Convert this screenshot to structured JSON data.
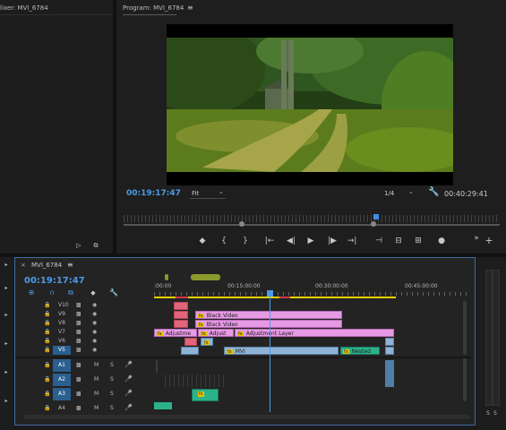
{
  "mixer_panel": {
    "title": "lixer: MVI_6784",
    "timecode": "",
    "bottom_icons": [
      "▸◂",
      "⧉"
    ]
  },
  "program_panel": {
    "title": "Program: MVI_6784",
    "menu_icon": "hamburger-icon",
    "timecode": "00:19:17:47",
    "fit_label": "Fit",
    "quality_label": "1/4",
    "duration": "00:40:29:41"
  },
  "transport": {
    "buttons": [
      "◆",
      "{",
      "}",
      "|←",
      "◀|",
      "▶",
      "|▶",
      "→|",
      "⊣",
      "⊟",
      "⊞",
      "●",
      "»",
      "+"
    ]
  },
  "timeline": {
    "tab_title": "MVI_6784",
    "timecode": "00:19:17:47",
    "ruler": [
      ":00:00",
      "00:15:00:00",
      "00:30:00:00",
      "00:45:00:00"
    ],
    "video_tracks": [
      "V10",
      "V9",
      "V8",
      "V7",
      "V6",
      "V5"
    ],
    "audio_tracks": [
      "A1",
      "A2",
      "A3",
      "A4"
    ],
    "audio_m": "M",
    "audio_s": "S",
    "clips": {
      "black_video_1": "Black Video",
      "black_video_2": "Black Video",
      "adjustme": "Adjustme",
      "adjust": "Adjust",
      "adjustment_layer": "Adjustment Layer",
      "mvi": "MVI",
      "nested": "Nested",
      "fx": "fx"
    }
  },
  "meter": {
    "labels": [
      "S",
      "S"
    ]
  },
  "colors": {
    "accent": "#4a9be8",
    "clip_pink": "#e79ae4",
    "clip_red": "#e2667b",
    "clip_cyan": "#8fb3d6",
    "clip_green": "#2bb28b",
    "work_area": "#e8d200"
  }
}
